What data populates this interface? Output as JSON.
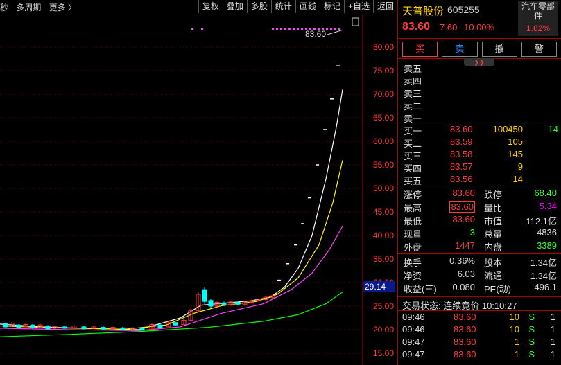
{
  "toolbar": {
    "left_items": [
      "秒",
      "多周期",
      "更多 〉"
    ],
    "buttons": [
      "复权",
      "叠加",
      "多股",
      "统计",
      "画线",
      "标记",
      "+自选",
      "返回"
    ]
  },
  "chart": {
    "price_labels": [
      "80.00",
      "75.00",
      "70.00",
      "65.00",
      "60.00",
      "55.00",
      "50.00",
      "45.00",
      "40.00",
      "35.00",
      "30.00",
      "25.00",
      "20.00",
      "15.00"
    ],
    "price_values": [
      80,
      75,
      70,
      65,
      60,
      55,
      50,
      45,
      40,
      35,
      30,
      25,
      20,
      15
    ],
    "current_price_tag": "29.14",
    "high_annotation": "83.60",
    "colors": {
      "up": "#ff3b3b",
      "down": "#00ffff",
      "ma1": "#ffffff",
      "ma2": "#ffff00",
      "ma3": "#ff40ff",
      "ma4": "#00ff00",
      "grid": "#8b0000"
    }
  },
  "quote": {
    "name": "天普股份",
    "code": "605255",
    "last": "83.60",
    "change": "7.60",
    "change_pct": "10.00%",
    "industry": "汽车零部件",
    "industry_pct": "1.82%",
    "trade_buttons": {
      "buy": "买",
      "sell": "卖",
      "cancel": "撤",
      "alert": "警"
    },
    "asks": [
      {
        "label": "卖五",
        "price": "",
        "vol": ""
      },
      {
        "label": "卖四",
        "price": "",
        "vol": ""
      },
      {
        "label": "卖三",
        "price": "",
        "vol": ""
      },
      {
        "label": "卖二",
        "price": "",
        "vol": ""
      },
      {
        "label": "卖一",
        "price": "",
        "vol": ""
      }
    ],
    "bids": [
      {
        "label": "买一",
        "price": "83.60",
        "vol": "100450",
        "chg": "-14"
      },
      {
        "label": "买二",
        "price": "83.59",
        "vol": "105",
        "chg": ""
      },
      {
        "label": "买三",
        "price": "83.58",
        "vol": "145",
        "chg": ""
      },
      {
        "label": "买四",
        "price": "83.57",
        "vol": "9",
        "chg": ""
      },
      {
        "label": "买五",
        "price": "83.56",
        "vol": "14",
        "chg": ""
      }
    ],
    "stats1": [
      [
        "涨停",
        "83.60",
        "跌停",
        "68.40"
      ],
      [
        "最高",
        "83.60",
        "量比",
        "5.34"
      ],
      [
        "最低",
        "83.60",
        "市值",
        "112.1亿"
      ],
      [
        "现量",
        "3",
        "总量",
        "4836"
      ],
      [
        "外盘",
        "1447",
        "内盘",
        "3389"
      ]
    ],
    "stats2": [
      [
        "换手",
        "0.36%",
        "股本",
        "1.34亿"
      ],
      [
        "净资",
        "6.03",
        "流通",
        "1.34亿"
      ],
      [
        "收益(三)",
        "0.080",
        "PE(动)",
        "496.1"
      ]
    ],
    "trade_status": "交易状态: 连续竞价 10:10:27",
    "ticks": [
      {
        "time": "09:46",
        "price": "83.60",
        "vol": "10",
        "side": "S",
        "num": "1"
      },
      {
        "time": "09:46",
        "price": "83.60",
        "vol": "10",
        "side": "S",
        "num": "1"
      },
      {
        "time": "09:47",
        "price": "83.60",
        "vol": "1",
        "side": "S",
        "num": "1"
      },
      {
        "time": "09:47",
        "price": "83.60",
        "vol": "1",
        "side": "S",
        "num": "1"
      }
    ]
  }
}
